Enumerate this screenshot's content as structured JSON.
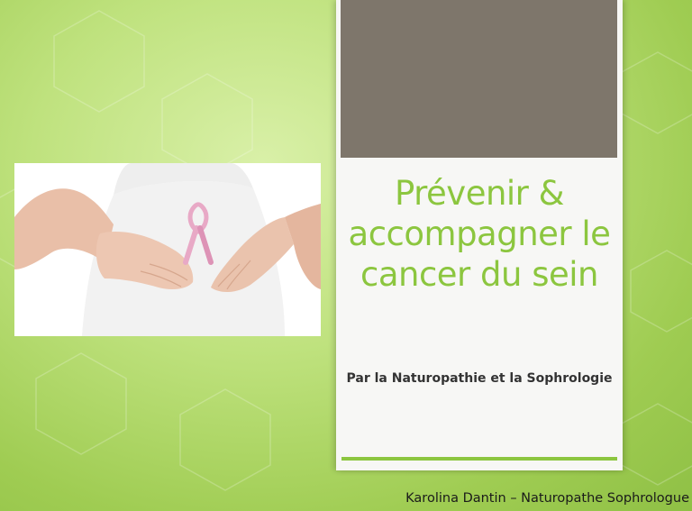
{
  "slide": {
    "title": "Prévenir & accompagner le cancer du sein",
    "subtitle": "Par la Naturopathie et la Sophrologie",
    "footer": "Karolina Dantin – Naturopathe Sophrologue"
  },
  "colors": {
    "background_green": "#9fcc52",
    "title_green": "#8cc63f",
    "panel_top_block": "#7e766b",
    "panel_background": "#f7f7f5",
    "ribbon_pink": "#e8a9c6"
  },
  "icons": {
    "photo": "pink-ribbon-photo"
  }
}
